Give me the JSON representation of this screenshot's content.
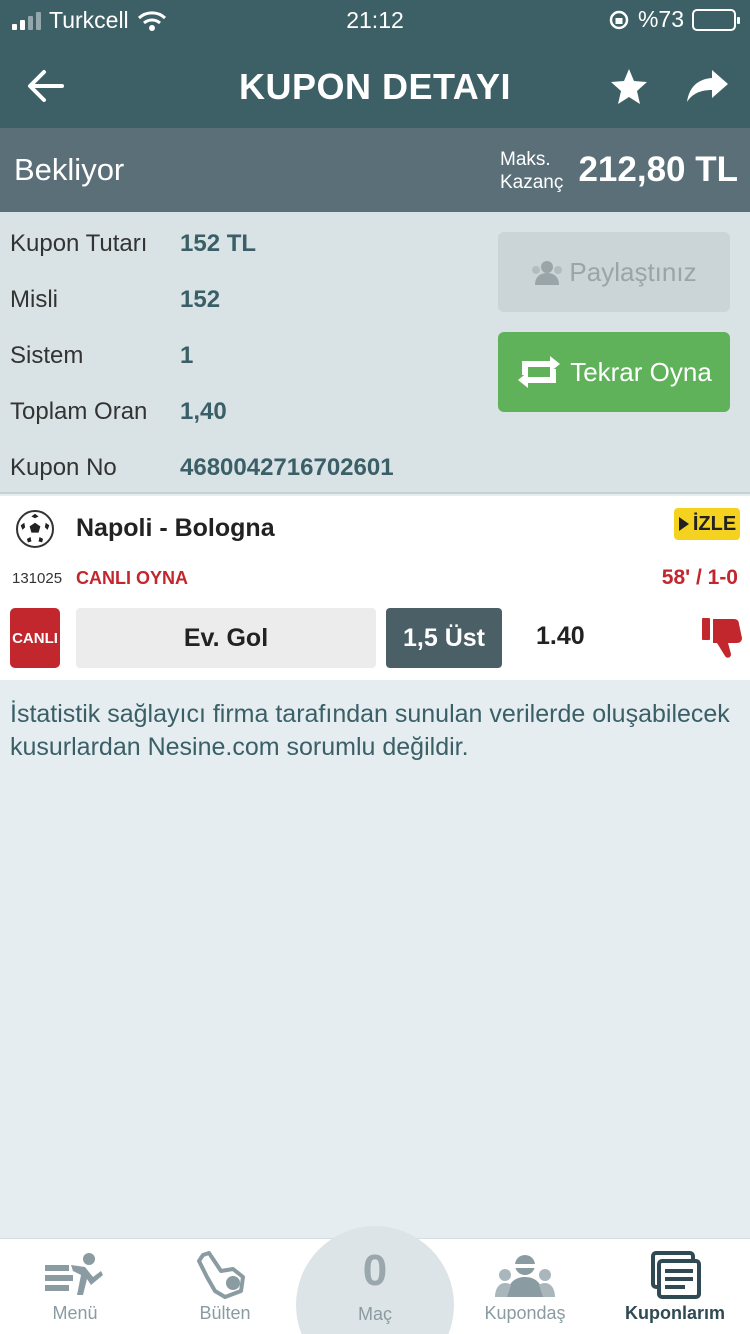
{
  "status_bar": {
    "carrier": "Turkcell",
    "time": "21:12",
    "battery_percent": "%73"
  },
  "header": {
    "title": "KUPON DETAYI"
  },
  "coupon_status": {
    "state": "Bekliyor",
    "max_win_label_1": "Maks.",
    "max_win_label_2": "Kazanç",
    "max_win_amount": "212,80 TL"
  },
  "details": [
    {
      "label": "Kupon Tutarı",
      "value": "152 TL"
    },
    {
      "label": "Misli",
      "value": "152"
    },
    {
      "label": "Sistem",
      "value": "1"
    },
    {
      "label": "Toplam Oran",
      "value": "1,40"
    },
    {
      "label": "Kupon No",
      "value": "4680042716702601"
    }
  ],
  "buttons": {
    "shared_label": "Paylaştınız",
    "replay_label": "Tekrar Oyna"
  },
  "match": {
    "teams": "Napoli - Bologna",
    "watch_label": "İZLE",
    "code": "131025",
    "live_play_label": "CANLI OYNA",
    "score": "58' / 1-0",
    "live_badge": "CANLI",
    "market": "Ev. Gol",
    "pick": "1,5 Üst",
    "odd": "1.40"
  },
  "disclaimer": "İstatistik sağlayıcı firma tarafından sunulan verilerde oluşabilecek kusurlardan Nesine.com sorumlu değildir.",
  "tabbar": {
    "items": [
      {
        "label": "Menü"
      },
      {
        "label": "Bülten"
      },
      {
        "label": "Maç",
        "count": "0"
      },
      {
        "label": "Kupondaş"
      },
      {
        "label": "Kuponlarım"
      }
    ]
  },
  "colors": {
    "header_bg": "#3d6066",
    "status_bg": "#5b6f79",
    "accent_green": "#5fb25a",
    "live_red": "#c1272d",
    "watch_yellow": "#f4d21f"
  }
}
